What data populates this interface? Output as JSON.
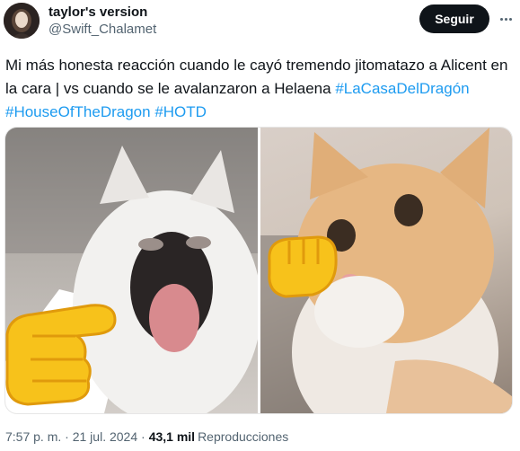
{
  "author": {
    "display_name": "taylor's version",
    "handle": "@Swift_Chalamet"
  },
  "follow_label": "Seguir",
  "tweet": {
    "text": "Mi más honesta reacción cuando le cayó tremendo jitomatazo a Alicent en la cara | vs cuando se le avalanzaron a Helaena ",
    "hashtags": [
      "#LaCasaDelDragón",
      "#HouseOfTheDragon",
      "#HOTD"
    ]
  },
  "media": {
    "left_icon": "pointing-hand-emoji-icon",
    "right_icon": "fist-bump-emoji-icon"
  },
  "footer": {
    "time": "7:57 p. m.",
    "separator": "·",
    "date": "21 jul. 2024",
    "separator2": "·",
    "views": "43,1 mil",
    "views_label": "Reproducciones"
  },
  "colors": {
    "accent": "#1d9bf0",
    "text": "#0f1419",
    "secondary": "#536471",
    "emoji_yellow": "#f7c21b"
  }
}
